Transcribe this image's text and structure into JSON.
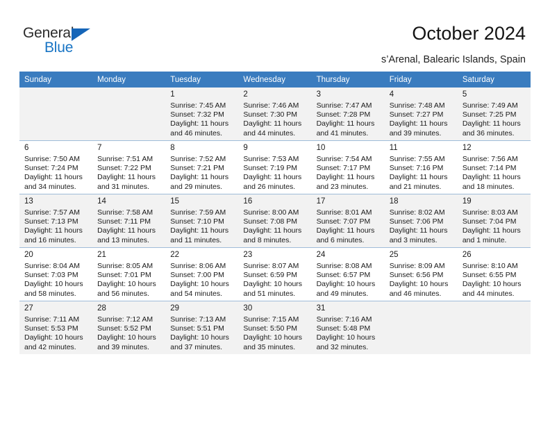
{
  "brand": {
    "name_top": "General",
    "name_bottom": "Blue",
    "triangle_color": "#1565b8",
    "blue_color": "#1874c4"
  },
  "header": {
    "title": "October 2024",
    "subtitle": "s’Arenal, Balearic Islands, Spain"
  },
  "theme": {
    "header_row_bg": "#3a7cbf",
    "header_row_text": "#ffffff",
    "shaded_row_bg": "#f2f2f2",
    "plain_row_bg": "#ffffff",
    "row_divider": "#9fbcd9"
  },
  "columns": [
    "Sunday",
    "Monday",
    "Tuesday",
    "Wednesday",
    "Thursday",
    "Friday",
    "Saturday"
  ],
  "weeks": [
    {
      "shaded": true,
      "days": [
        null,
        null,
        {
          "day": "1",
          "sunrise": "Sunrise: 7:45 AM",
          "sunset": "Sunset: 7:32 PM",
          "daylight": "Daylight: 11 hours and 46 minutes."
        },
        {
          "day": "2",
          "sunrise": "Sunrise: 7:46 AM",
          "sunset": "Sunset: 7:30 PM",
          "daylight": "Daylight: 11 hours and 44 minutes."
        },
        {
          "day": "3",
          "sunrise": "Sunrise: 7:47 AM",
          "sunset": "Sunset: 7:28 PM",
          "daylight": "Daylight: 11 hours and 41 minutes."
        },
        {
          "day": "4",
          "sunrise": "Sunrise: 7:48 AM",
          "sunset": "Sunset: 7:27 PM",
          "daylight": "Daylight: 11 hours and 39 minutes."
        },
        {
          "day": "5",
          "sunrise": "Sunrise: 7:49 AM",
          "sunset": "Sunset: 7:25 PM",
          "daylight": "Daylight: 11 hours and 36 minutes."
        }
      ]
    },
    {
      "shaded": false,
      "days": [
        {
          "day": "6",
          "sunrise": "Sunrise: 7:50 AM",
          "sunset": "Sunset: 7:24 PM",
          "daylight": "Daylight: 11 hours and 34 minutes."
        },
        {
          "day": "7",
          "sunrise": "Sunrise: 7:51 AM",
          "sunset": "Sunset: 7:22 PM",
          "daylight": "Daylight: 11 hours and 31 minutes."
        },
        {
          "day": "8",
          "sunrise": "Sunrise: 7:52 AM",
          "sunset": "Sunset: 7:21 PM",
          "daylight": "Daylight: 11 hours and 29 minutes."
        },
        {
          "day": "9",
          "sunrise": "Sunrise: 7:53 AM",
          "sunset": "Sunset: 7:19 PM",
          "daylight": "Daylight: 11 hours and 26 minutes."
        },
        {
          "day": "10",
          "sunrise": "Sunrise: 7:54 AM",
          "sunset": "Sunset: 7:17 PM",
          "daylight": "Daylight: 11 hours and 23 minutes."
        },
        {
          "day": "11",
          "sunrise": "Sunrise: 7:55 AM",
          "sunset": "Sunset: 7:16 PM",
          "daylight": "Daylight: 11 hours and 21 minutes."
        },
        {
          "day": "12",
          "sunrise": "Sunrise: 7:56 AM",
          "sunset": "Sunset: 7:14 PM",
          "daylight": "Daylight: 11 hours and 18 minutes."
        }
      ]
    },
    {
      "shaded": true,
      "days": [
        {
          "day": "13",
          "sunrise": "Sunrise: 7:57 AM",
          "sunset": "Sunset: 7:13 PM",
          "daylight": "Daylight: 11 hours and 16 minutes."
        },
        {
          "day": "14",
          "sunrise": "Sunrise: 7:58 AM",
          "sunset": "Sunset: 7:11 PM",
          "daylight": "Daylight: 11 hours and 13 minutes."
        },
        {
          "day": "15",
          "sunrise": "Sunrise: 7:59 AM",
          "sunset": "Sunset: 7:10 PM",
          "daylight": "Daylight: 11 hours and 11 minutes."
        },
        {
          "day": "16",
          "sunrise": "Sunrise: 8:00 AM",
          "sunset": "Sunset: 7:08 PM",
          "daylight": "Daylight: 11 hours and 8 minutes."
        },
        {
          "day": "17",
          "sunrise": "Sunrise: 8:01 AM",
          "sunset": "Sunset: 7:07 PM",
          "daylight": "Daylight: 11 hours and 6 minutes."
        },
        {
          "day": "18",
          "sunrise": "Sunrise: 8:02 AM",
          "sunset": "Sunset: 7:06 PM",
          "daylight": "Daylight: 11 hours and 3 minutes."
        },
        {
          "day": "19",
          "sunrise": "Sunrise: 8:03 AM",
          "sunset": "Sunset: 7:04 PM",
          "daylight": "Daylight: 11 hours and 1 minute."
        }
      ]
    },
    {
      "shaded": false,
      "days": [
        {
          "day": "20",
          "sunrise": "Sunrise: 8:04 AM",
          "sunset": "Sunset: 7:03 PM",
          "daylight": "Daylight: 10 hours and 58 minutes."
        },
        {
          "day": "21",
          "sunrise": "Sunrise: 8:05 AM",
          "sunset": "Sunset: 7:01 PM",
          "daylight": "Daylight: 10 hours and 56 minutes."
        },
        {
          "day": "22",
          "sunrise": "Sunrise: 8:06 AM",
          "sunset": "Sunset: 7:00 PM",
          "daylight": "Daylight: 10 hours and 54 minutes."
        },
        {
          "day": "23",
          "sunrise": "Sunrise: 8:07 AM",
          "sunset": "Sunset: 6:59 PM",
          "daylight": "Daylight: 10 hours and 51 minutes."
        },
        {
          "day": "24",
          "sunrise": "Sunrise: 8:08 AM",
          "sunset": "Sunset: 6:57 PM",
          "daylight": "Daylight: 10 hours and 49 minutes."
        },
        {
          "day": "25",
          "sunrise": "Sunrise: 8:09 AM",
          "sunset": "Sunset: 6:56 PM",
          "daylight": "Daylight: 10 hours and 46 minutes."
        },
        {
          "day": "26",
          "sunrise": "Sunrise: 8:10 AM",
          "sunset": "Sunset: 6:55 PM",
          "daylight": "Daylight: 10 hours and 44 minutes."
        }
      ]
    },
    {
      "shaded": true,
      "days": [
        {
          "day": "27",
          "sunrise": "Sunrise: 7:11 AM",
          "sunset": "Sunset: 5:53 PM",
          "daylight": "Daylight: 10 hours and 42 minutes."
        },
        {
          "day": "28",
          "sunrise": "Sunrise: 7:12 AM",
          "sunset": "Sunset: 5:52 PM",
          "daylight": "Daylight: 10 hours and 39 minutes."
        },
        {
          "day": "29",
          "sunrise": "Sunrise: 7:13 AM",
          "sunset": "Sunset: 5:51 PM",
          "daylight": "Daylight: 10 hours and 37 minutes."
        },
        {
          "day": "30",
          "sunrise": "Sunrise: 7:15 AM",
          "sunset": "Sunset: 5:50 PM",
          "daylight": "Daylight: 10 hours and 35 minutes."
        },
        {
          "day": "31",
          "sunrise": "Sunrise: 7:16 AM",
          "sunset": "Sunset: 5:48 PM",
          "daylight": "Daylight: 10 hours and 32 minutes."
        },
        null,
        null
      ]
    }
  ]
}
